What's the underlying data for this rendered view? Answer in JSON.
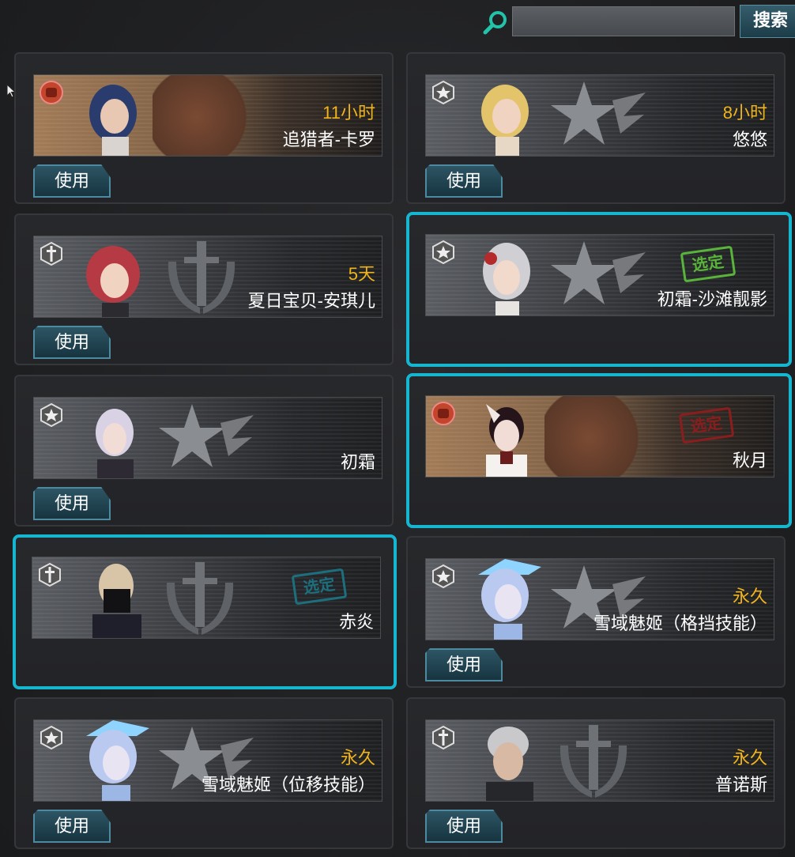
{
  "search": {
    "button_label": "搜索",
    "placeholder": ""
  },
  "colors": {
    "selected_border": "#16b6d1",
    "duration_text": "#f0b41c"
  },
  "cards": [
    {
      "name": "追猎者-卡罗",
      "duration": "11小时",
      "class_icon": "fist-icon",
      "use_label": "使用"
    },
    {
      "name": "悠悠",
      "duration": "8小时",
      "class_icon": "star-icon",
      "use_label": "使用"
    },
    {
      "name": "夏日宝贝-安琪儿",
      "duration": "5天",
      "class_icon": "sword-icon",
      "use_label": "使用"
    },
    {
      "name": "初霜-沙滩靓影",
      "duration": "",
      "class_icon": "star-icon",
      "stamp": "选定",
      "selected": true
    },
    {
      "name": "初霜",
      "duration": "",
      "class_icon": "star-icon",
      "use_label": "使用"
    },
    {
      "name": "秋月",
      "duration": "",
      "class_icon": "fist-icon",
      "stamp": "选定",
      "selected": true
    },
    {
      "name": "赤炎",
      "duration": "",
      "class_icon": "sword-icon",
      "stamp": "选定",
      "selected": true
    },
    {
      "name": "雪域魅姬（格挡技能）",
      "duration": "永久",
      "class_icon": "star-icon",
      "use_label": "使用"
    },
    {
      "name": "雪域魅姬（位移技能）",
      "duration": "永久",
      "class_icon": "star-icon",
      "use_label": "使用"
    },
    {
      "name": "普诺斯",
      "duration": "永久",
      "class_icon": "sword-icon",
      "use_label": "使用"
    }
  ]
}
